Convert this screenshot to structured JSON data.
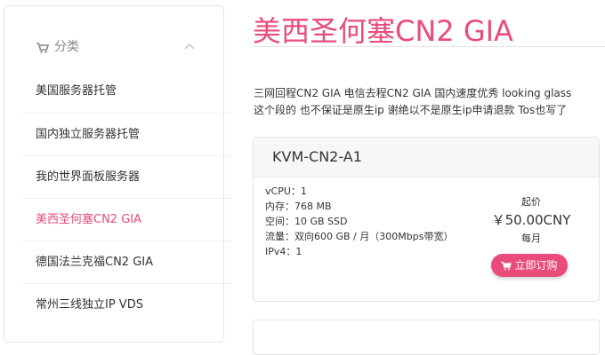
{
  "sidebar": {
    "title": "分类",
    "items": [
      {
        "label": "美国服务器托管",
        "active": false
      },
      {
        "label": "国内独立服务器托管",
        "active": false
      },
      {
        "label": "我的世界面板服务器",
        "active": false
      },
      {
        "label": "美西圣何塞CN2 GIA",
        "active": true
      },
      {
        "label": "德国法兰克福CN2 GIA",
        "active": false
      },
      {
        "label": "常州三线独立IP VDS",
        "active": false
      }
    ]
  },
  "main": {
    "title": "美西圣何塞CN2 GIA",
    "description_line1": "三网回程CN2 GIA 电信去程CN2 GIA 国内速度优秀 looking glass",
    "description_line2": "这个段的 也不保证是原生ip 谢绝以不是原生ip申请退款 Tos也写了"
  },
  "product": {
    "name": "KVM-CN2-A1",
    "specs": {
      "vcpu": "vCPU：1",
      "memory": "内存：768 MB",
      "disk": "空间：10 GB SSD",
      "traffic": "流量：双向600 GB / 月（300Mbps带宽）",
      "ipv4": "IPv4：1"
    },
    "price_from": "起价",
    "price": "￥50.00CNY",
    "cycle": "每月",
    "order_label": "立即订购"
  },
  "colors": {
    "accent": "#e94c7a"
  }
}
